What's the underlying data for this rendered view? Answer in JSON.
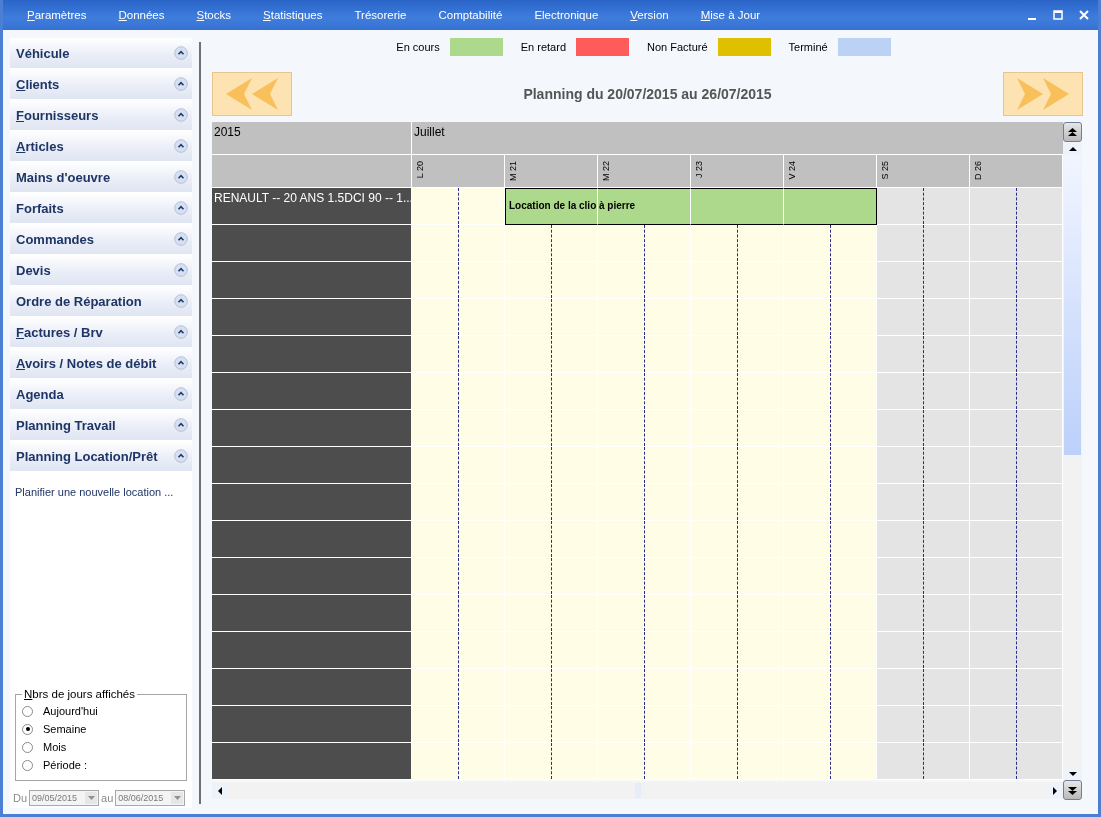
{
  "menu": [
    {
      "label": "Paramètres",
      "underline_first": true
    },
    {
      "label": "Données",
      "underline_first": true
    },
    {
      "label": "Stocks",
      "underline_first": true
    },
    {
      "label": "Statistiques",
      "underline_first": true
    },
    {
      "label": "Trésorerie",
      "underline_first": false
    },
    {
      "label": "Comptabilité",
      "underline_first": false
    },
    {
      "label": "Electronique",
      "underline_first": false
    },
    {
      "label": "Version",
      "underline_first": true
    },
    {
      "label": "Mise à Jour",
      "underline_first": true
    }
  ],
  "sidebar": {
    "sections": [
      {
        "label": "Véhicule",
        "underline_first": false
      },
      {
        "label": "Clients",
        "underline_first": true
      },
      {
        "label": "Fournisseurs",
        "underline_first": true
      },
      {
        "label": "Articles",
        "underline_first": true
      },
      {
        "label": "Mains d'oeuvre",
        "underline_first": false
      },
      {
        "label": "Forfaits",
        "underline_first": false
      },
      {
        "label": "Commandes",
        "underline_first": false
      },
      {
        "label": "Devis",
        "underline_first": false
      },
      {
        "label": "Ordre de Réparation",
        "underline_first": false
      },
      {
        "label": "Factures / Brv",
        "underline_first": true
      },
      {
        "label": "Avoirs / Notes de débit",
        "underline_first": true
      },
      {
        "label": "Agenda",
        "underline_first": false
      },
      {
        "label": "Planning Travail",
        "underline_first": false
      },
      {
        "label": "Planning Location/Prêt",
        "underline_first": false,
        "links": [
          "Planifier une nouvelle location ..."
        ]
      }
    ]
  },
  "days_shown": {
    "title": "Nbrs de jours affichés",
    "underline_first": true,
    "options": [
      {
        "label": "Aujourd'hui",
        "selected": false
      },
      {
        "label": "Semaine",
        "selected": true
      },
      {
        "label": "Mois",
        "selected": false
      },
      {
        "label": "Période :",
        "selected": false
      }
    ],
    "from_label": "Du",
    "from": {
      "value": "09/05/2015",
      "disabled": true
    },
    "to_label": "au",
    "to": {
      "value": "08/06/2015",
      "disabled": true
    }
  },
  "legend": [
    {
      "label": "En cours",
      "color": "#acd98b"
    },
    {
      "label": "En retard",
      "color": "#fe5b5b"
    },
    {
      "label": "Non Facturé",
      "color": "#dfc000"
    },
    {
      "label": "Terminé",
      "color": "#bcd2f5"
    }
  ],
  "planning": {
    "title": "Planning du 20/07/2015 au 26/07/2015",
    "year": "2015",
    "month": "Juillet",
    "days": [
      {
        "label": "L 20",
        "weekend": false
      },
      {
        "label": "M 21",
        "weekend": false
      },
      {
        "label": "M 22",
        "weekend": false
      },
      {
        "label": "J 23",
        "weekend": false
      },
      {
        "label": "V 24",
        "weekend": false
      },
      {
        "label": "S 25",
        "weekend": true
      },
      {
        "label": "D 26",
        "weekend": true
      }
    ],
    "rows": [
      {
        "label": "RENAULT -- 20 ANS 1.5DCI 90 -- 1...",
        "booking": {
          "label": "Location de la clio à pierre",
          "color": "#acd98b"
        },
        "cells": [
          {
            "booked": false
          },
          {
            "booked": true
          },
          {
            "booked": true
          },
          {
            "booked": true
          },
          {
            "booked": true
          },
          {
            "booked": false
          },
          {
            "booked": false
          }
        ]
      }
    ]
  }
}
